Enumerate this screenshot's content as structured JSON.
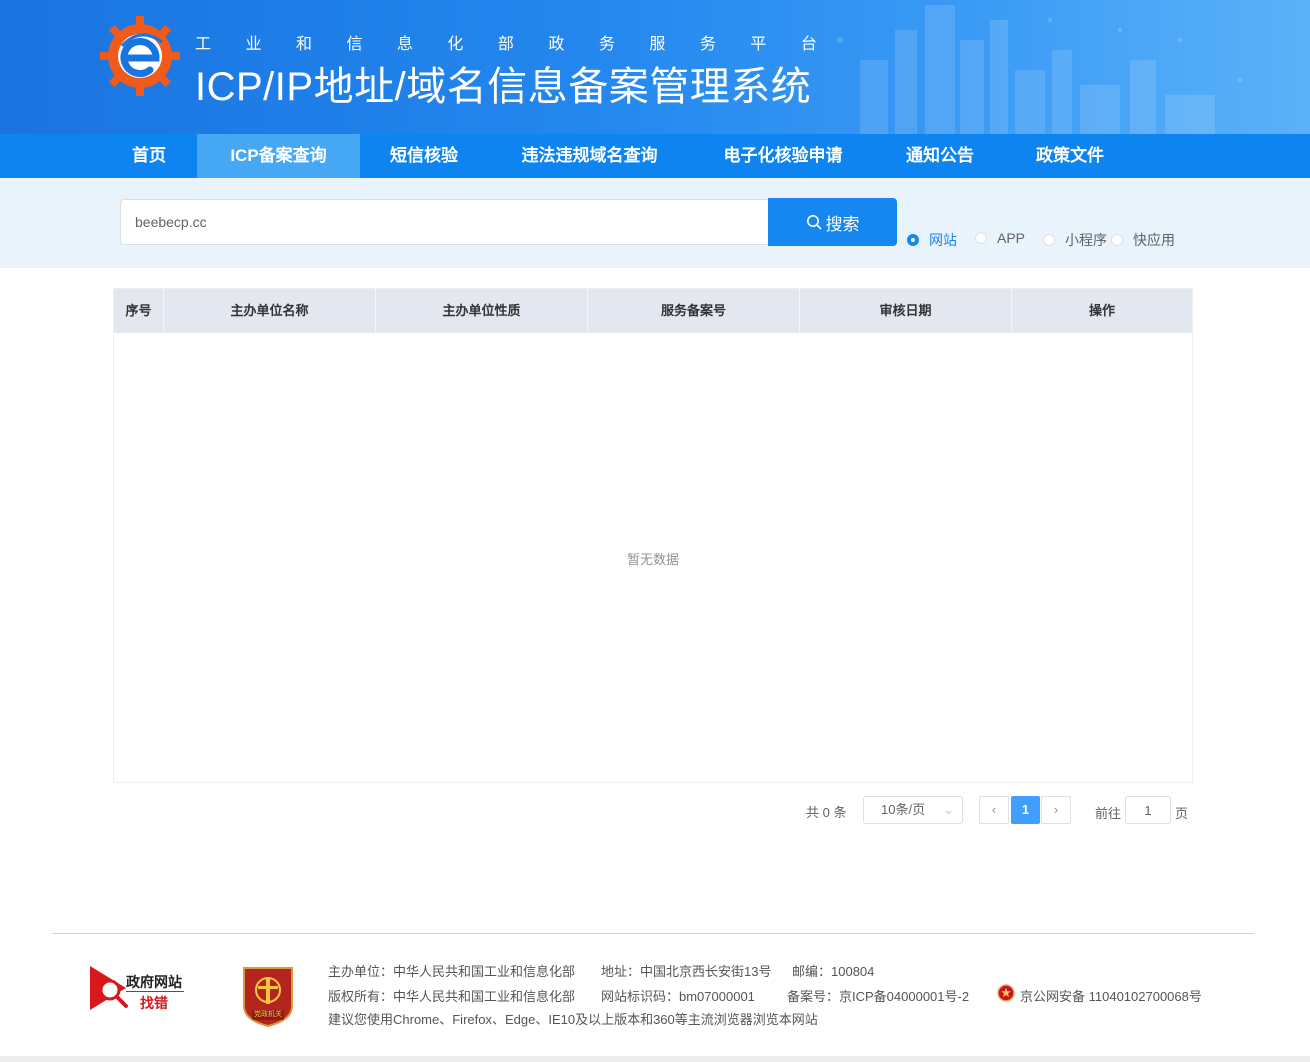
{
  "header": {
    "platform_chars": [
      "工",
      "业",
      "和",
      "信",
      "息",
      "化",
      "部",
      "政",
      "务",
      "服",
      "务",
      "平",
      "台"
    ],
    "system_title": "ICP/IP地址/域名信息备案管理系统",
    "logo_icon": "miit-gear-e-logo-icon"
  },
  "nav": {
    "items": [
      {
        "label": "首页"
      },
      {
        "label": "ICP备案查询",
        "active": true
      },
      {
        "label": "短信核验"
      },
      {
        "label": "违法违规域名查询"
      },
      {
        "label": "电子化核验申请"
      },
      {
        "label": "通知公告"
      },
      {
        "label": "政策文件"
      }
    ]
  },
  "search": {
    "value": "beebecp.cc",
    "button_label": "搜索",
    "button_icon": "search-icon",
    "types": [
      {
        "label": "网站",
        "checked": true
      },
      {
        "label": "APP"
      },
      {
        "label": "小程序"
      },
      {
        "label": "快应用"
      }
    ]
  },
  "table": {
    "columns": [
      "序号",
      "主办单位名称",
      "主办单位性质",
      "服务备案号",
      "审核日期",
      "操作"
    ],
    "rows": [],
    "empty_text": "暂无数据"
  },
  "pagination": {
    "total_text": "共 0 条",
    "page_size": "10条/页",
    "current_page": "1",
    "goto_prefix": "前往",
    "goto_value": "1",
    "goto_suffix": "页"
  },
  "footer": {
    "gov_badge": {
      "line1": "政府网站",
      "line2": "找错"
    },
    "party_badge_text": "党政机关",
    "host": "主办单位：中华人民共和国工业和信息化部",
    "address": "地址：中国北京西长安街13号",
    "postcode": "邮编：100804",
    "copyright": "版权所有：中华人民共和国工业和信息化部",
    "site_code": "网站标识码：bm07000001",
    "icp": "备案号：京ICP备04000001号-2",
    "police": "京公网安备 11040102700068号",
    "browser_tip": "建议您使用Chrome、Firefox、Edge、IE10及以上版本和360等主流浏览器浏览本网站"
  },
  "colors": {
    "header_blue": "#1a74e0",
    "nav_blue": "#0d84ef",
    "nav_active": "#46a8f5",
    "search_button": "#1686f0",
    "search_band": "#e9f3fc",
    "table_header": "#e2e7f0",
    "pager_active": "#409eff"
  }
}
